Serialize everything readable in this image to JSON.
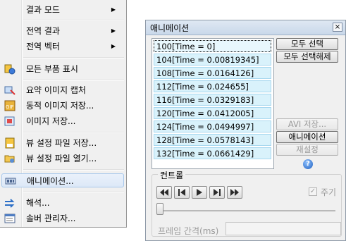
{
  "menu": {
    "items": [
      {
        "label": "결과 모드",
        "submenu": true,
        "icon": ""
      },
      {
        "label": "전역 결과",
        "submenu": true,
        "icon": ""
      },
      {
        "label": "전역 벡터",
        "submenu": true,
        "icon": ""
      },
      {
        "label": "모든 부품 표시",
        "submenu": false,
        "icon": "show-parts-icon"
      },
      {
        "label": "요약 이미지 캡처",
        "submenu": false,
        "icon": "capture-icon"
      },
      {
        "label": "동적 이미지 저장...",
        "submenu": false,
        "icon": "gif-save-icon"
      },
      {
        "label": "이미지 저장...",
        "submenu": false,
        "icon": "image-save-icon"
      },
      {
        "label": "뷰 설정 파일 저장...",
        "submenu": false,
        "icon": "save-view-icon"
      },
      {
        "label": "뷰 설정 파일 열기...",
        "submenu": false,
        "icon": "open-view-icon"
      },
      {
        "label": "애니메이션...",
        "submenu": false,
        "icon": "animation-icon",
        "highlighted": true
      },
      {
        "label": "해석...",
        "submenu": false,
        "icon": "analysis-icon"
      },
      {
        "label": "솔버 관리자...",
        "submenu": false,
        "icon": "solver-manager-icon"
      }
    ]
  },
  "animation_window": {
    "title": "애니메이션",
    "close": "×",
    "frames": [
      "100[Time = 0]",
      "104[Time = 0.00819345]",
      "108[Time = 0.0164126]",
      "112[Time = 0.024655]",
      "116[Time = 0.0329183]",
      "120[Time = 0.0412005]",
      "124[Time = 0.0494997]",
      "128[Time = 0.0578143]",
      "132[Time = 0.0661429]"
    ],
    "buttons": {
      "select_all": "모두 선택",
      "deselect_all": "모두 선택해제",
      "avi_save": "AVI 저장...",
      "animation": "애니메이션",
      "reset": "재설정",
      "help": "?"
    },
    "control": {
      "group_label": "컨트롤",
      "cycle_label": "주기",
      "cycle_checked": true,
      "interval_label": "프레임 간격(ms)",
      "interval_value": ""
    }
  }
}
